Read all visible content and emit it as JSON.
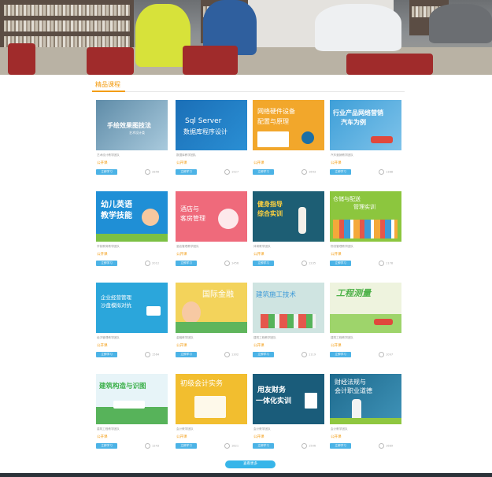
{
  "section": {
    "title": "精品课程"
  },
  "courses": [
    {
      "thumb_title": "手绘效果图技法",
      "thumb_sub": "艺术设计类",
      "meta": "艺术设计教学团队",
      "price": "公开课",
      "enroll": "立即学习",
      "views": "2856"
    },
    {
      "thumb_title": "Sql Server",
      "thumb_sub": "数据库程序设计",
      "meta": "数据库教学团队",
      "price": "公开课",
      "enroll": "立即学习",
      "views": "1927"
    },
    {
      "thumb_title": "网络硬件设备",
      "thumb_sub": "配置与原理",
      "meta": "",
      "price": "公开课",
      "enroll": "立即学习",
      "views": "1643"
    },
    {
      "thumb_title": "行业产品网络营销",
      "thumb_sub": "汽车为例",
      "meta": "汽车营销教学团队",
      "price": "公开课",
      "enroll": "立即学习",
      "views": "1388"
    },
    {
      "thumb_title": "幼儿英语",
      "thumb_sub": "教学技能",
      "meta": "学前教育教学团队",
      "price": "公开课",
      "enroll": "立即学习",
      "views": "2012"
    },
    {
      "thumb_title": "酒店与",
      "thumb_sub": "客房管理",
      "meta": "酒店管理教学团队",
      "price": "公开课",
      "enroll": "立即学习",
      "views": "1456"
    },
    {
      "thumb_title": "健身指导",
      "thumb_sub": "综合实训",
      "meta": "体育教学团队",
      "price": "公开课",
      "enroll": "立即学习",
      "views": "1235"
    },
    {
      "thumb_title": "仓储与配送",
      "thumb_sub": "管理实训",
      "meta": "物流管理教学团队",
      "price": "公开课",
      "enroll": "立即学习",
      "views": "1178"
    },
    {
      "thumb_title": "企业经营管理",
      "thumb_sub": "沙盘模拟对抗",
      "meta": "经济管理教学团队",
      "price": "公开课",
      "enroll": "立即学习",
      "views": "1564"
    },
    {
      "thumb_title": "国际金融",
      "thumb_sub": "",
      "meta": "金融教学团队",
      "price": "公开课",
      "enroll": "立即学习",
      "views": "1302"
    },
    {
      "thumb_title": "建筑施工技术",
      "thumb_sub": "",
      "meta": "建筑工程教学团队",
      "price": "公开课",
      "enroll": "立即学习",
      "views": "1119"
    },
    {
      "thumb_title": "工程测量",
      "thumb_sub": "",
      "meta": "建筑工程教学团队",
      "price": "公开课",
      "enroll": "立即学习",
      "views": "1097"
    },
    {
      "thumb_title": "建筑构造与识图",
      "thumb_sub": "",
      "meta": "建筑工程教学团队",
      "price": "公开课",
      "enroll": "立即学习",
      "views": "1243"
    },
    {
      "thumb_title": "初级会计实务",
      "thumb_sub": "",
      "meta": "会计教学团队",
      "price": "公开课",
      "enroll": "立即学习",
      "views": "1821"
    },
    {
      "thumb_title": "用友财务",
      "thumb_sub": "一体化实训",
      "meta": "会计教学团队",
      "price": "公开课",
      "enroll": "立即学习",
      "views": "1506"
    },
    {
      "thumb_title": "财经法规与",
      "thumb_sub": "会计职业道德",
      "meta": "会计教学团队",
      "price": "公开课",
      "enroll": "立即学习",
      "views": "1689"
    }
  ],
  "more_label": "查看更多"
}
